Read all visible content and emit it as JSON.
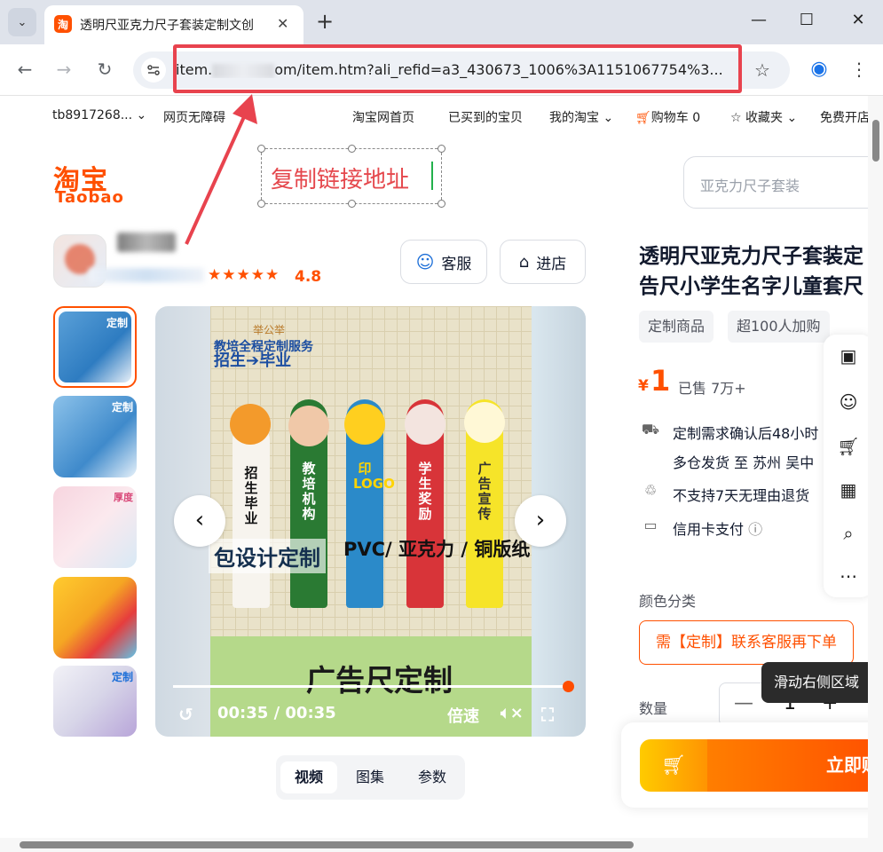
{
  "browser": {
    "tab_title": "透明尺亚克力尺子套装定制文创",
    "tab_favicon": "淘",
    "url_prefix": "item.",
    "url_rest": "om/item.htm?ali_refid=a3_430673_1006%3A1151067754%3...",
    "close_tab": "✕",
    "new_tab": "+",
    "minimize": "—",
    "maximize": "☐",
    "close_window": "✕"
  },
  "sitebar": {
    "user": "tb8917268...",
    "accessibility": "网页无障碍",
    "home": "淘宝网首页",
    "bought": "已买到的宝贝",
    "my_taobao": "我的淘宝",
    "cart": "购物车 0",
    "favorites": "收藏夹",
    "open_shop": "免费开店"
  },
  "logo": {
    "cn": "淘宝",
    "en": "Taobao"
  },
  "search": {
    "placeholder": "亚克力尺子套装"
  },
  "annotation": {
    "text": "复制链接地址"
  },
  "shop": {
    "stars": "★★★★★",
    "rating": "4.8",
    "service_label": "客服",
    "enter_label": "进店"
  },
  "thumbnails": {
    "tag1": "定制",
    "tag2": "定制",
    "tag3": "厚度",
    "tag5": "定制"
  },
  "video": {
    "badge_top": "教培全程定制服务",
    "badge_main": "招生➔毕业",
    "brand": "举公举",
    "ruler1": "招生毕业",
    "ruler2": "教培机构",
    "ruler3": "印LOGO",
    "ruler4": "学生奖励",
    "ruler5": "广告宣传",
    "banner_left": "包设计定制",
    "banner_right": "PVC/ 亚克力 / 铜版纸",
    "bottom_text": "广告尺定制",
    "time": "00:35 / 00:35",
    "speed": "倍速",
    "prev": "‹",
    "next": "›",
    "progress": 1.0
  },
  "media_tabs": [
    "视频",
    "图集",
    "参数"
  ],
  "product": {
    "title_line1": "透明尺亚克力尺子套装定",
    "title_line2": "告尺小学生名字儿童套尺",
    "tag1": "定制商品",
    "tag2": "超100人加购",
    "price_symbol": "¥",
    "price": "1",
    "sold": "已售 7万+",
    "ship1": "定制需求确认后48小时",
    "ship2": "多仓发货 至 苏州 吴中",
    "no_return": "不支持7天无理由退货",
    "credit": "信用卡支付",
    "color_label": "颜色分类",
    "option": "需【定制】联系客服再下单",
    "qty_label": "数量",
    "qty_value": "1",
    "buy_now": "立即购买",
    "tooltip": "滑动右侧区域"
  },
  "colors": {
    "accent": "#ff5000",
    "annotation": "#e5484d"
  }
}
